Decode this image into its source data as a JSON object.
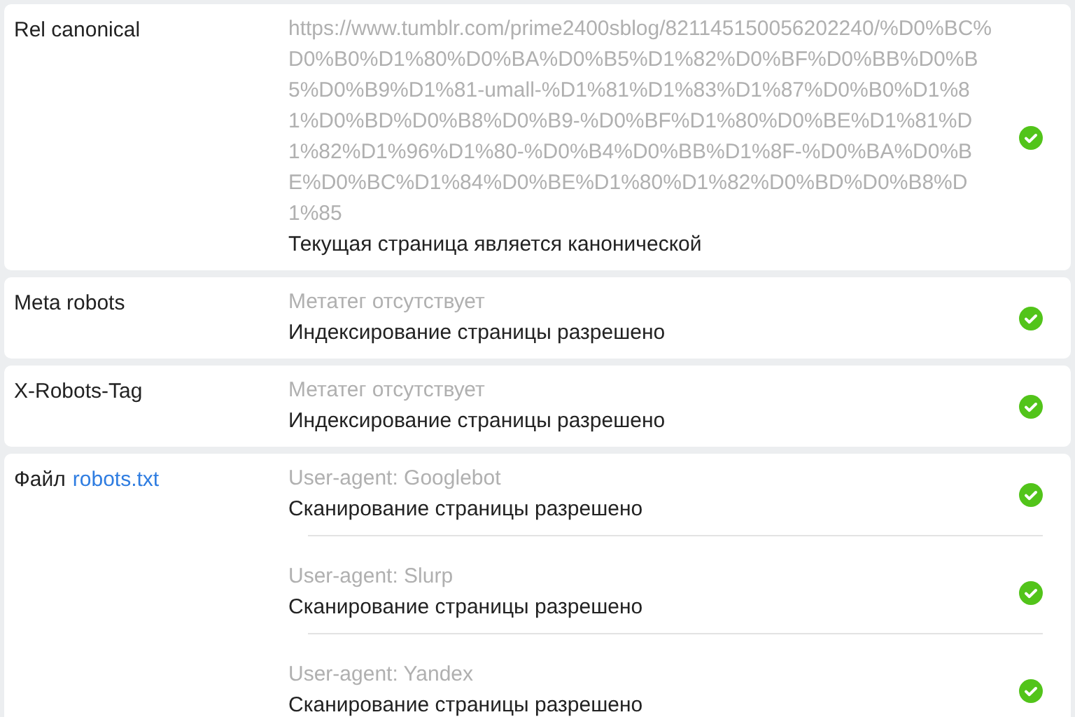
{
  "rows": [
    {
      "label": "Rel canonical",
      "entries": [
        {
          "detail": "https://www.tumblr.com/prime2400sblog/821145150056202240/%D0%BC%D0%B0%D1%80%D0%BA%D0%B5%D1%82%D0%BF%D0%BB%D0%B5%D0%B9%D1%81-umall-%D1%81%D1%83%D1%87%D0%B0%D1%81%D0%BD%D0%B8%D0%B9-%D0%BF%D1%80%D0%BE%D1%81%D1%82%D1%96%D1%80-%D0%B4%D0%BB%D1%8F-%D0%BA%D0%BE%D0%BC%D1%84%D0%BE%D1%80%D1%82%D0%BD%D0%B8%D1%85",
          "result": "Текущая страница является канонической",
          "passed": true
        }
      ]
    },
    {
      "label": "Meta robots",
      "entries": [
        {
          "detail": "Метатег отсутствует",
          "result": "Индексирование страницы разрешено",
          "passed": true
        }
      ]
    },
    {
      "label": "X-Robots-Tag",
      "entries": [
        {
          "detail": "Метатег отсутствует",
          "result": "Индексирование страницы разрешено",
          "passed": true
        }
      ]
    },
    {
      "label": "Файл",
      "link": "robots.txt",
      "entries": [
        {
          "detail": "User-agent: Googlebot",
          "result": "Сканирование страницы разрешено",
          "passed": true
        },
        {
          "detail": "User-agent: Slurp",
          "result": "Сканирование страницы разрешено",
          "passed": true
        },
        {
          "detail": "User-agent: Yandex",
          "result": "Сканирование страницы разрешено",
          "passed": true
        }
      ]
    }
  ]
}
